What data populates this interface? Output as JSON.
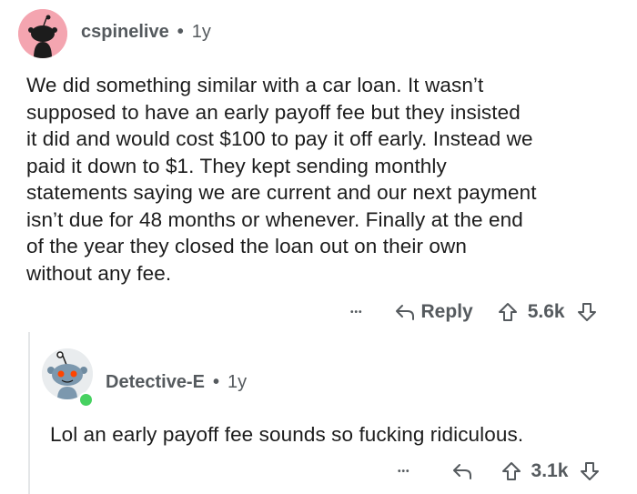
{
  "comment1": {
    "username": "cspinelive",
    "separator": "•",
    "age": "1y",
    "lines": [
      "We did something similar with a car loan. It wasn’t",
      "supposed to have an early payoff fee but they insisted",
      "it did and would cost $100 to pay it off early. Instead we",
      "paid it down to $1. They kept sending monthly",
      "statements saying we are current and our next payment",
      "isn’t due for 48 months or whenever. Finally at the end",
      "of the year they closed the loan out on their own",
      "without any fee."
    ],
    "actions": {
      "more": "•••",
      "reply_label": "Reply",
      "score": "5.6k"
    }
  },
  "comment2": {
    "username": "Detective-E",
    "separator": "•",
    "age": "1y",
    "text": "Lol an early payoff fee sounds so fucking ridiculous.",
    "actions": {
      "more": "•••",
      "score": "3.1k"
    }
  },
  "colors": {
    "avatar1_bg": "#f4a5b0",
    "avatar2_bg": "#e9ecee",
    "online": "#46d160",
    "meta_text": "#555a5e"
  },
  "icons": {
    "reply": "reply-arrow-icon",
    "upvote": "upvote-arrow-icon",
    "downvote": "downvote-arrow-icon",
    "more": "more-options-icon"
  }
}
